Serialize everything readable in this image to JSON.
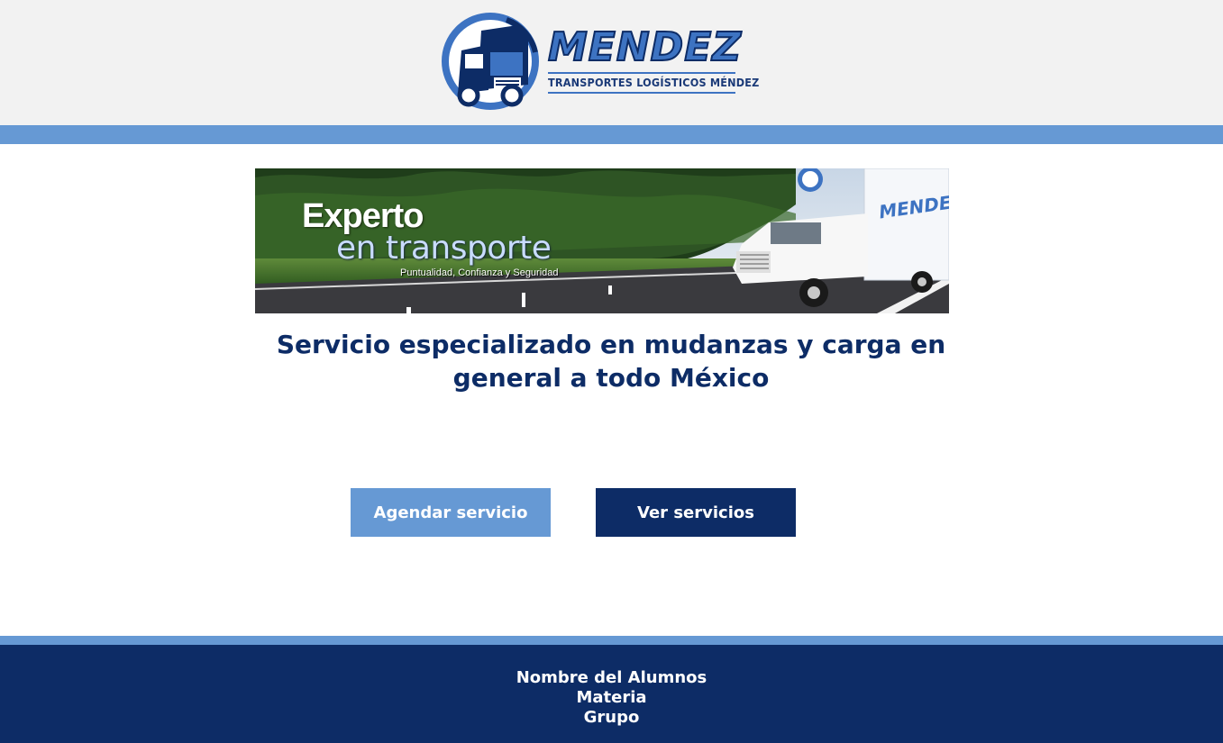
{
  "header": {
    "logo": {
      "title": "MENDEZ",
      "subtitle": "Transportes Logísticos Méndez",
      "icon": "truck-logo-icon"
    }
  },
  "banner": {
    "line1": "Experto",
    "line2": "en transporte",
    "line3": "Puntualidad, Confianza y Seguridad",
    "truck_text": "MENDEZ"
  },
  "main": {
    "headline": "Servicio especializado en mudanzas y carga en general a todo México",
    "buttons": {
      "schedule_label": "Agendar servicio",
      "services_label": "Ver servicios"
    }
  },
  "footer": {
    "line1": "Nombre del Alumnos",
    "line2": "Materia",
    "line3": "Grupo"
  },
  "colors": {
    "header_bg": "#f2f2f2",
    "accent_light": "#6699d4",
    "accent_dark": "#0d2c66",
    "text_dark": "#0d2c66"
  }
}
